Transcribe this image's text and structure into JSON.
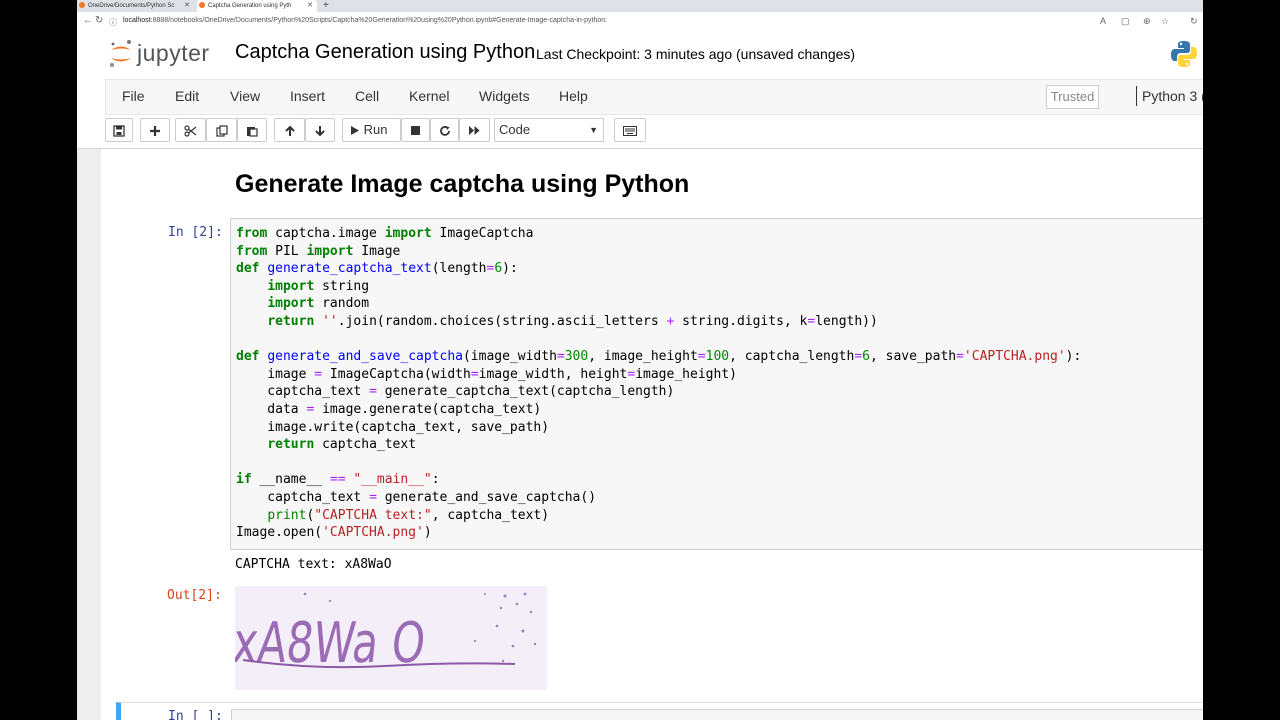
{
  "browser": {
    "tabs": [
      {
        "label": "OneDrive/Documents/Python Sc"
      },
      {
        "label": "Captcha Generation using Pyth"
      }
    ],
    "new_tab": "+",
    "url_host": "localhost",
    "url_rest": ":8888/notebooks/OneDrive/Documents/Python%20Scripts/Captcha%20Generation%20using%20Python.ipynb#Generate-Image-captcha-in-python:"
  },
  "header": {
    "logo_text": "jupyter",
    "notebook_title": "Captcha Generation using Python",
    "checkpoint": "Last Checkpoint: 3 minutes ago",
    "unsaved": "(unsaved changes)"
  },
  "menubar": {
    "items": [
      "File",
      "Edit",
      "View",
      "Insert",
      "Cell",
      "Kernel",
      "Widgets",
      "Help"
    ],
    "trusted": "Trusted",
    "kernel": "Python 3 ("
  },
  "toolbar": {
    "run_label": "Run",
    "cell_type": "Code"
  },
  "notebook": {
    "heading": "Generate Image captcha using Python",
    "in_prompt": "In [2]:",
    "out_prompt": "Out[2]:",
    "output_text": "CAPTCHA text: xA8WaO",
    "next_prompt": "In [ ]:",
    "captcha_image_text": "xA8Wa O"
  },
  "colors": {
    "in_prompt": "#303f9f",
    "out_prompt": "#d84315",
    "keyword": "#008000",
    "function": "#0000ff",
    "string": "#ba2121",
    "selected_cell": "#42a5f5"
  }
}
